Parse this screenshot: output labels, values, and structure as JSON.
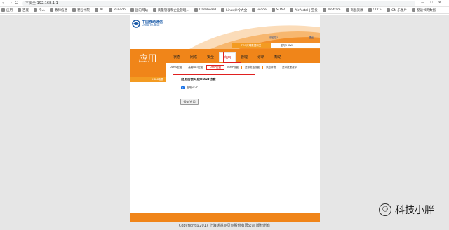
{
  "browser": {
    "nav_back": "←",
    "nav_forward": "→",
    "nav_reload": "C",
    "security_label": "不安全",
    "url": "192.168.1.1",
    "window_controls": "—  ☐  ✕",
    "bookmarks": [
      "应用",
      "百度",
      "个人",
      "教师信息",
      "翟园书院",
      "NL",
      "Runoob",
      "国内网站",
      "质量管理和企业管理...",
      "Dashboard",
      "Linux命令大全",
      "vcode",
      "SOAR",
      "AirPortal | 空投",
      "Wolfram",
      "商品资源",
      "CDCE",
      "GN 乐图片",
      "翟读书网数据"
    ]
  },
  "router": {
    "logo_text": "中国移动通信",
    "logo_sub": "CHINA MOBILE",
    "welcome": "欢迎您!",
    "logout": "退出",
    "pon_label": "PON终端数据网关",
    "model": "型号:HGW",
    "section_title": "应用",
    "menu": [
      "状态",
      "网络",
      "安全",
      "应用",
      "管理",
      "诊断",
      "帮助"
    ],
    "active_menu": "应用",
    "submenu": [
      "DDNS配置",
      "高级NAT配置",
      "UPnP配置",
      "IGMP设置",
      "宽带电话设置",
      "家庭存储",
      "宽带提速及中"
    ],
    "active_submenu": "UPnP配置",
    "sidebar_item": "UPnP配置",
    "content": {
      "title": "启用后会开启UPnP功能",
      "checkbox_label": "启用UPnP",
      "checkbox_checked": true,
      "save_button": "保存/应用"
    },
    "footer": "Copyright@2017 上海诺基亚贝尔股份有限公司 版权所有"
  },
  "watermark": {
    "text": "科技小胖"
  },
  "colors": {
    "orange": "#f08519",
    "highlight_red": "#e02020"
  }
}
